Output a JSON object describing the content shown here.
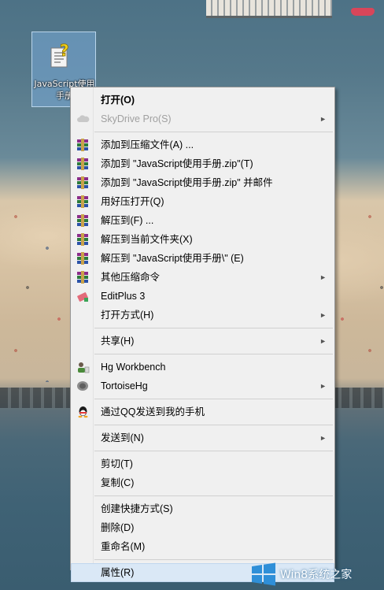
{
  "desktop": {
    "icon_label": "JavaScript使用手册"
  },
  "menu": {
    "items": [
      {
        "label": "打开(O)",
        "bold": true
      },
      {
        "label": "SkyDrive Pro(S)",
        "disabled": true,
        "submenu": true,
        "icon": "cloud-icon"
      },
      {
        "label": "添加到压缩文件(A) ...",
        "icon": "winrar-icon"
      },
      {
        "label": "添加到 \"JavaScript使用手册.zip\"(T)",
        "icon": "winrar-icon"
      },
      {
        "label": "添加到 \"JavaScript使用手册.zip\" 并邮件",
        "icon": "winrar-icon"
      },
      {
        "label": "用好压打开(Q)",
        "icon": "winrar-icon"
      },
      {
        "label": "解压到(F) ...",
        "icon": "winrar-icon"
      },
      {
        "label": "解压到当前文件夹(X)",
        "icon": "winrar-icon"
      },
      {
        "label": "解压到 \"JavaScript使用手册\\\" (E)",
        "icon": "winrar-icon"
      },
      {
        "label": "其他压缩命令",
        "icon": "winrar-icon",
        "submenu": true
      },
      {
        "label": "EditPlus 3",
        "icon": "editplus-icon"
      },
      {
        "label": "打开方式(H)",
        "submenu": true
      },
      {
        "label": "共享(H)",
        "submenu": true
      },
      {
        "label": "Hg Workbench",
        "icon": "hg-workbench-icon"
      },
      {
        "label": "TortoiseHg",
        "icon": "tortoisehg-icon",
        "submenu": true
      },
      {
        "label": "通过QQ发送到我的手机",
        "icon": "qq-icon"
      },
      {
        "label": "发送到(N)",
        "submenu": true
      },
      {
        "label": "剪切(T)"
      },
      {
        "label": "复制(C)"
      },
      {
        "label": "创建快捷方式(S)"
      },
      {
        "label": "删除(D)"
      },
      {
        "label": "重命名(M)"
      },
      {
        "label": "属性(R)",
        "hover": true
      }
    ],
    "arrow_glyph": "►"
  },
  "watermark": {
    "text": "Win8系统之家"
  },
  "colors": {
    "menu_bg": "#f0f0f0",
    "hover_bg": "#dae8f6",
    "icon_highlight": "#7aa9d6",
    "winlogo": "#2f8fd8"
  }
}
